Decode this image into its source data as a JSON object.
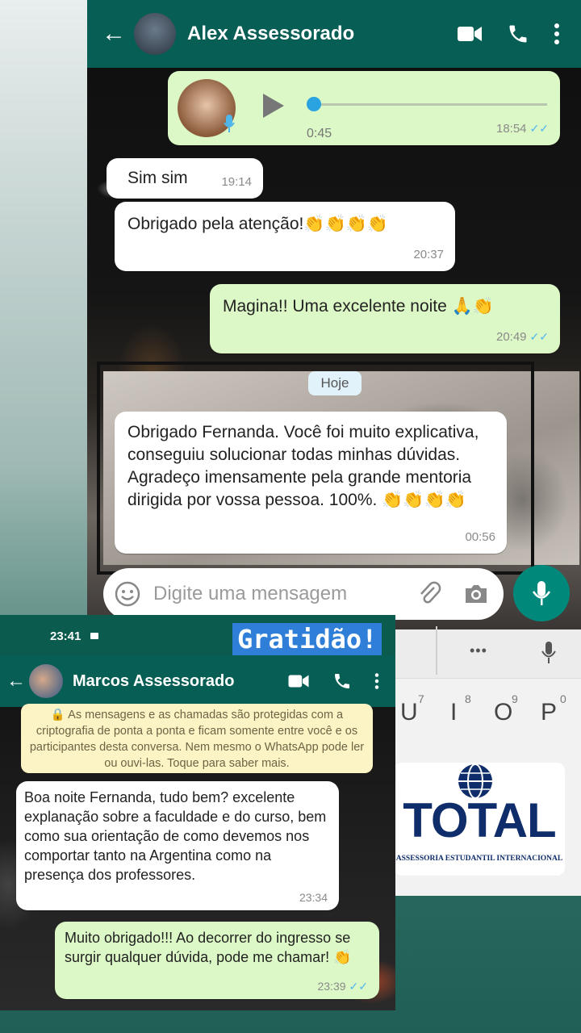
{
  "top_chat": {
    "contact_name": "Alex Assessorado",
    "audio": {
      "duration": "0:45",
      "time": "18:54"
    },
    "messages": [
      {
        "dir": "in",
        "text": "Sim sim",
        "time": "19:14"
      },
      {
        "dir": "in",
        "text": "Obrigado pela atenção!👏👏👏👏",
        "time": "20:37"
      },
      {
        "dir": "out",
        "text": "Magina!! Uma excelente noite 🙏👏",
        "time": "20:49"
      },
      {
        "dir": "in",
        "text": "Obrigado Fernanda. Você foi muito explicativa, conseguiu solucionar todas minhas dúvidas.  Agradeço imensamente pela grande mentoria dirigida por vossa pessoa. 100%. 👏👏👏👏",
        "time": "00:56"
      }
    ],
    "date_divider": "Hoje",
    "input_placeholder": "Digite uma mensagem",
    "icons": {
      "back": "back-arrow-icon",
      "video": "video-call-icon",
      "call": "phone-icon",
      "menu": "more-vert-icon",
      "emoji": "emoji-icon",
      "attach": "paperclip-icon",
      "camera": "camera-icon",
      "mic": "mic-icon",
      "play": "play-icon"
    }
  },
  "overlay_label": "Gratidão!",
  "keyboard": {
    "keys": [
      "U",
      "I",
      "O",
      "P"
    ],
    "numbers": [
      "7",
      "8",
      "9",
      "0"
    ],
    "toolbar_dots": "•••"
  },
  "logo": {
    "name": "TOTAL",
    "tagline": "ASSESSORIA ESTUDANTIL INTERNACIONAL"
  },
  "bottom_chat": {
    "status_time": "23:41",
    "contact_name": "Marcos Assessorado",
    "encryption_notice": "As mensagens e as chamadas são protegidas com a criptografia de ponta a ponta e ficam somente entre você e os participantes desta conversa. Nem mesmo o WhatsApp pode ler ou ouvi-las. Toque para saber mais.",
    "messages": [
      {
        "dir": "in",
        "text": "Boa noite Fernanda,  tudo bem?  excelente explanação   sobre a faculdade e do curso, bem como sua orientação de como devemos nos comportar tanto na Argentina como na presença dos professores.",
        "time": "23:34"
      },
      {
        "dir": "out",
        "text": "Muito obrigado!!! Ao decorrer do ingresso se surgir qualquer dúvida, pode me chamar! 👏",
        "time": "23:39"
      }
    ]
  },
  "colors": {
    "header": "#075e54",
    "outgoing": "#dcf8c6",
    "incoming": "#ffffff",
    "ticks": "#4fb6ec",
    "mic_button": "#00897b",
    "label_bg": "#2f7fd9"
  }
}
